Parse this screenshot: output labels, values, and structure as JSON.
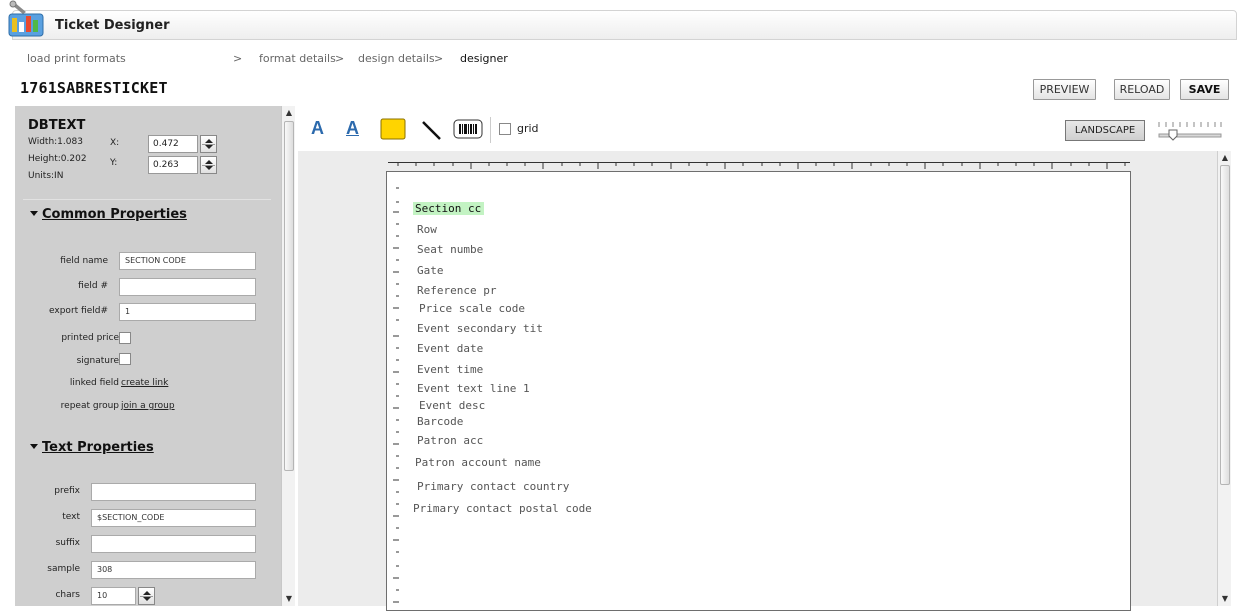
{
  "app": {
    "title": "Ticket Designer",
    "logo_icon": "ticket-designer-logo"
  },
  "breadcrumb": {
    "step1": "load print formats",
    "sep1": ">",
    "step2": "format details",
    "sep2": ">",
    "step3": "design details",
    "sep3": ">",
    "current": "designer"
  },
  "page_title": "1761SABRESTICKET",
  "toolbar": {
    "preview": "PREVIEW",
    "reload": "RELOAD",
    "save": "SAVE",
    "grid_label": "grid",
    "grid_checked": false,
    "landscape": "LANDSCAPE"
  },
  "element": {
    "type": "DBTEXT",
    "width": "Width:1.083",
    "height": "Height:0.202",
    "units": "Units:IN",
    "x_label": "X:",
    "x_value": "0.472",
    "y_label": "Y:",
    "y_value": "0.263"
  },
  "common": {
    "heading": "Common Properties",
    "field_name_label": "field name",
    "field_name_value": "SECTION CODE",
    "field_num_label": "field #",
    "field_num_value": "",
    "export_field_label": "export field#",
    "export_field_value": "1",
    "printed_price_label": "printed price",
    "printed_price_checked": false,
    "signature_label": "signature",
    "signature_checked": false,
    "linked_field_label": "linked field",
    "linked_field_link": "create link",
    "repeat_group_label": "repeat group",
    "repeat_group_link": "join a group"
  },
  "text_props": {
    "heading": "Text Properties",
    "prefix_label": "prefix",
    "prefix_value": "",
    "text_label": "text",
    "text_value": "$SECTION_CODE",
    "suffix_label": "suffix",
    "suffix_value": "",
    "sample_label": "sample",
    "sample_value": "308",
    "chars_label": "chars",
    "chars_value": "10"
  },
  "ticket_fields": [
    "Section cc",
    "Row",
    "Seat numbe",
    "Gate",
    "Reference pr",
    "Price scale code",
    "Event secondary tit",
    "Event date",
    "Event time",
    "Event text line 1",
    "Event desc",
    "Barcode",
    "Patron acc",
    "Patron account name",
    "Primary contact country",
    "Primary contact postal code"
  ],
  "colors": {
    "accent_blue": "#2c6aad",
    "selection_green": "#c3f3c3",
    "panel_gray": "#cfcfcf",
    "rect_tool_yellow": "#ffd400"
  }
}
